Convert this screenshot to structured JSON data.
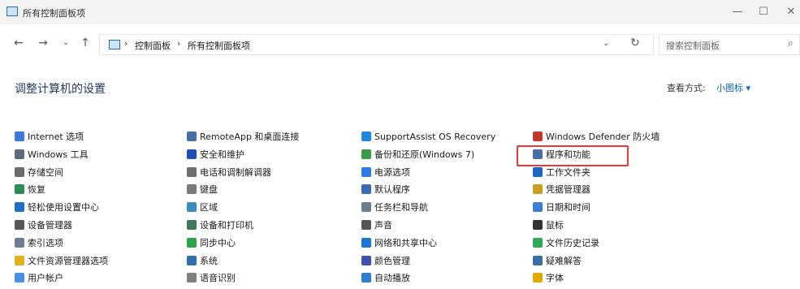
{
  "window": {
    "title": "所有控制面板项",
    "minimize_icon": "minimize-icon",
    "maximize_icon": "maximize-icon",
    "close_icon": "close-icon"
  },
  "nav": {
    "back_icon": "back-arrow-icon",
    "forward_icon": "forward-arrow-icon",
    "recent_icon": "chevron-down-icon",
    "up_icon": "up-arrow-icon"
  },
  "address": {
    "crumbs": [
      "控制面板",
      "所有控制面板项"
    ],
    "separator": "›",
    "refresh_icon": "refresh-icon"
  },
  "search": {
    "placeholder": "搜索控制面板",
    "icon": "search-icon"
  },
  "header": {
    "title": "调整计算机的设置",
    "view_by_label": "查看方式:",
    "view_by_value": "小图标 ▾"
  },
  "items": [
    [
      "Internet 选项",
      "Windows 工具",
      "存储空间",
      "恢复",
      "轻松使用设置中心",
      "设备管理器",
      "索引选项",
      "文件资源管理器选项",
      "用户帐户"
    ],
    [
      "RemoteApp 和桌面连接",
      "安全和维护",
      "电话和调制解调器",
      "键盘",
      "区域",
      "设备和打印机",
      "同步中心",
      "系统",
      "语音识别"
    ],
    [
      "SupportAssist OS Recovery",
      "备份和还原(Windows 7)",
      "电源选项",
      "默认程序",
      "任务栏和导航",
      "声音",
      "网络和共享中心",
      "颜色管理",
      "自动播放"
    ],
    [
      "Windows Defender 防火墙",
      "程序和功能",
      "工作文件夹",
      "凭据管理器",
      "日期和时间",
      "鼠标",
      "文件历史记录",
      "疑难解答",
      "字体"
    ]
  ],
  "icon_colors": [
    [
      "#3a7bd5",
      "#5a6b7b",
      "#6b6b6b",
      "#2e8b57",
      "#1f6fc2",
      "#555555",
      "#6a7f95",
      "#e0b020",
      "#4a90e2"
    ],
    [
      "#4a6fa5",
      "#1f4fb4",
      "#707070",
      "#7a7a7a",
      "#3c8dbc",
      "#3d7a5a",
      "#2aa34a",
      "#2f6fb0",
      "#808080"
    ],
    [
      "#1e88e5",
      "#3a9a4a",
      "#2c7be5",
      "#3b6db3",
      "#6b7f91",
      "#555555",
      "#1976d2",
      "#3f51b5",
      "#2f7fd0"
    ],
    [
      "#c0392b",
      "#4a6fa5",
      "#1f66c2",
      "#c8a020",
      "#3b7fd0",
      "#333333",
      "#2eaa55",
      "#3a6ea5",
      "#e0a800"
    ]
  ]
}
